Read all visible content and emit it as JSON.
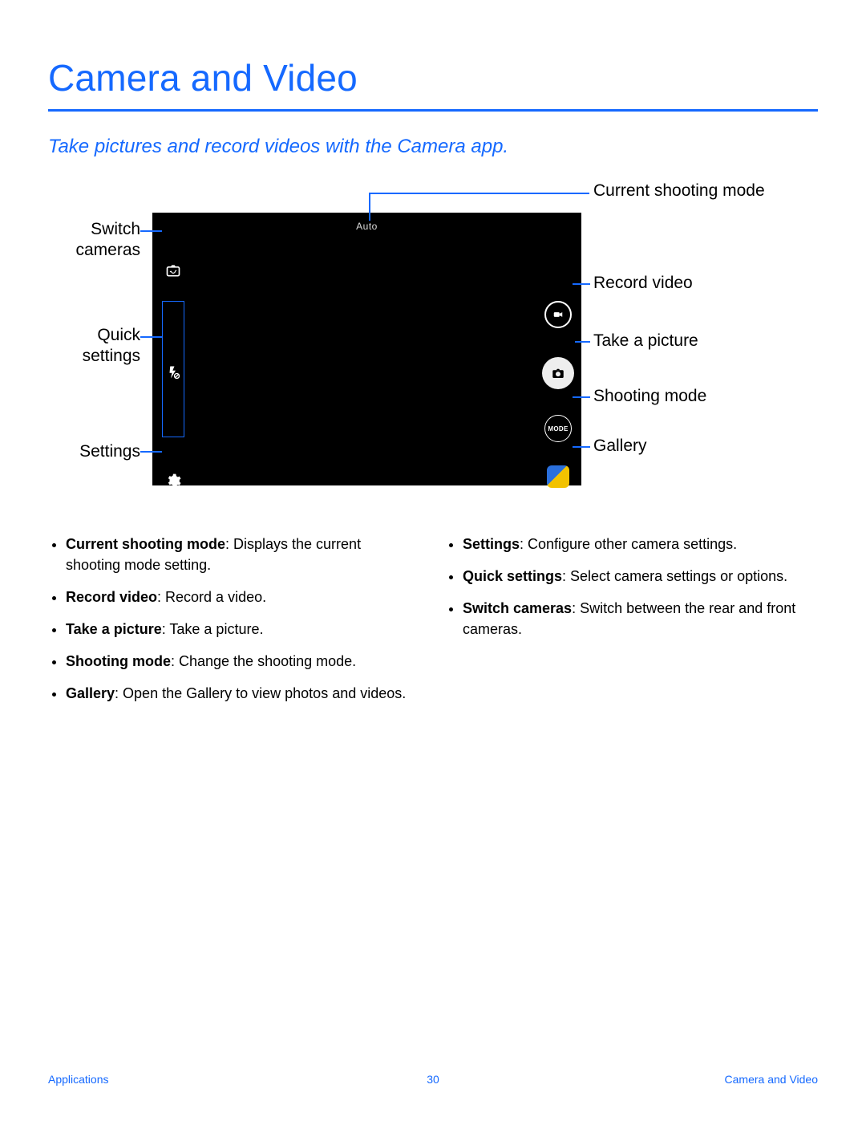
{
  "title": "Camera and Video",
  "subtitle": "Take pictures and record videos with the Camera app.",
  "viewer": {
    "mode_label": "Auto",
    "mode_button_text": "MODE"
  },
  "callouts": {
    "switch_cameras": "Switch cameras",
    "quick_settings": "Quick settings",
    "settings": "Settings",
    "current_mode": "Current shooting mode",
    "record_video": "Record video",
    "take_picture": "Take a picture",
    "shooting_mode": "Shooting mode",
    "gallery": "Gallery"
  },
  "bullets": {
    "left": [
      {
        "term": "Current shooting mode",
        "desc": ": Displays the current shooting mode setting."
      },
      {
        "term": "Record video",
        "desc": ": Record a video."
      },
      {
        "term": "Take a picture",
        "desc": ": Take a picture."
      },
      {
        "term": "Shooting mode",
        "desc": ": Change the shooting mode."
      },
      {
        "term": "Gallery",
        "desc": ": Open the Gallery to view photos and videos."
      }
    ],
    "right": [
      {
        "term": "Settings",
        "desc": ": Configure other camera settings."
      },
      {
        "term": "Quick settings",
        "desc": ": Select camera settings or options."
      },
      {
        "term": "Switch cameras",
        "desc": ": Switch between the rear and front cameras."
      }
    ]
  },
  "footer": {
    "left": "Applications",
    "center": "30",
    "right": "Camera and Video"
  }
}
